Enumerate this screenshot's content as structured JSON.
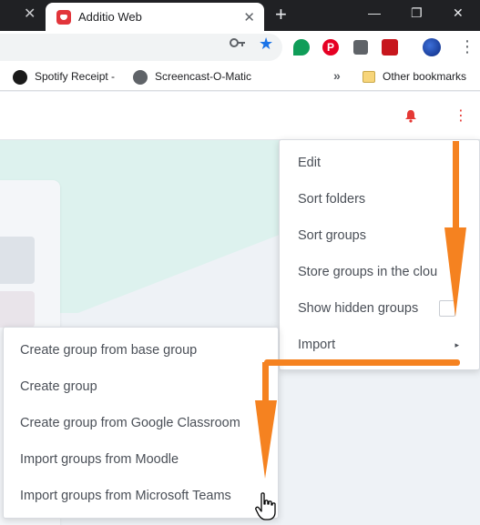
{
  "browser": {
    "tab_title": "Additio Web",
    "tab_close": "✕",
    "prev_tab_close": "✕",
    "new_tab": "+",
    "window_controls": [
      "—",
      "❐",
      "✕"
    ]
  },
  "bookmarks": {
    "items": [
      {
        "label": "Spotify  Receipt -",
        "icon": "spotify-icon"
      },
      {
        "label": "Screencast-O-Matic",
        "icon": "globe-icon"
      }
    ],
    "more": "»",
    "other": "Other bookmarks"
  },
  "app": {
    "accent_color": "#e53935",
    "icons": [
      "bell-icon",
      "more-vert-icon"
    ]
  },
  "main_menu": {
    "items": [
      {
        "label": "Edit"
      },
      {
        "label": "Sort folders"
      },
      {
        "label": "Sort groups"
      },
      {
        "label": "Store groups in the clou"
      },
      {
        "label": "Show hidden groups"
      },
      {
        "label": "Import"
      }
    ],
    "import_arrow": "▸"
  },
  "import_submenu": {
    "items": [
      {
        "label": "Create group from base group"
      },
      {
        "label": "Create group"
      },
      {
        "label": "Create group from Google Classroom"
      },
      {
        "label": "Import groups from Moodle"
      },
      {
        "label": "Import groups from Microsoft Teams"
      }
    ]
  },
  "annotation_color": "#f58220"
}
